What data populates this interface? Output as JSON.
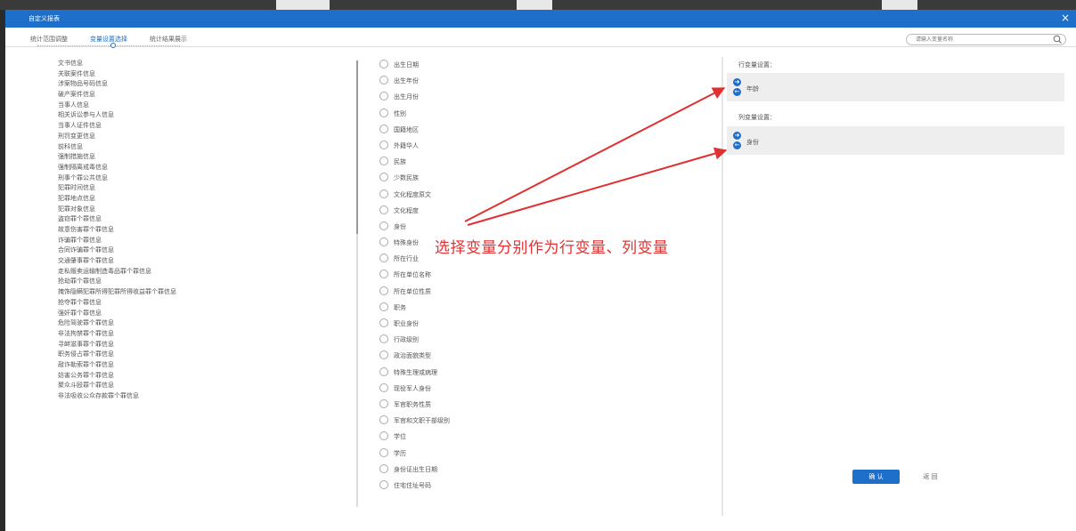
{
  "window": {
    "title": "自定义报表",
    "close": "×"
  },
  "tabs": [
    {
      "label": "统计范围调整"
    },
    {
      "label": "变量设置选择"
    },
    {
      "label": "统计结果展示"
    }
  ],
  "search": {
    "placeholder": "请输入变量名称"
  },
  "left_items": [
    "文书信息",
    "关联案件信息",
    "涉案物品号码信息",
    "破产案件信息",
    "当事人信息",
    "相关诉讼参与人信息",
    "当事人证件信息",
    "刑罚变更信息",
    "前科信息",
    "强制措施信息",
    "强制隔离戒毒信息",
    "刑事个罪公共信息",
    "犯罪时间信息",
    "犯罪地点信息",
    "犯罪对象信息",
    "盗窃罪个罪信息",
    "故意伤害罪个罪信息",
    "诈骗罪个罪信息",
    "合同诈骗罪个罪信息",
    "交通肇事罪个罪信息",
    "走私贩卖运输制造毒品罪个罪信息",
    "抢劫罪个罪信息",
    "掩饰隐瞒犯罪所得犯罪所得收益罪个罪信息",
    "抢夺罪个罪信息",
    "强奸罪个罪信息",
    "危险驾驶罪个罪信息",
    "非法拘禁罪个罪信息",
    "寻衅滋事罪个罪信息",
    "职务侵占罪个罪信息",
    "敲诈勒索罪个罪信息",
    "妨害公务罪个罪信息",
    "聚众斗殴罪个罪信息",
    "非法吸收公众存款罪个罪信息"
  ],
  "middle_items": [
    "出生日期",
    "出生年份",
    "出生月份",
    "性别",
    "国籍地区",
    "外籍华人",
    "民族",
    "少数民族",
    "文化程度原文",
    "文化程度",
    "身份",
    "特殊身份",
    "所在行业",
    "所在单位名称",
    "所在单位性质",
    "职务",
    "职业身份",
    "行政级别",
    "政治面貌类型",
    "特殊生理或病理",
    "现役军人身份",
    "军官职务性质",
    "军官和文职干部级别",
    "学位",
    "学历",
    "身份证出生日期",
    "住宅住址号码"
  ],
  "right": {
    "row_title": "行变量设置：",
    "row_value": "年龄",
    "col_title": "列变量设置：",
    "col_value": "身份",
    "arrow_right": "➜",
    "arrow_left": "←"
  },
  "buttons": {
    "ok": "确 认",
    "back": "返 回"
  },
  "annotation": {
    "text": "选择变量分别作为行变量、列变量",
    "color": "#e03030"
  },
  "colors": {
    "accent": "#1e6fc9"
  }
}
